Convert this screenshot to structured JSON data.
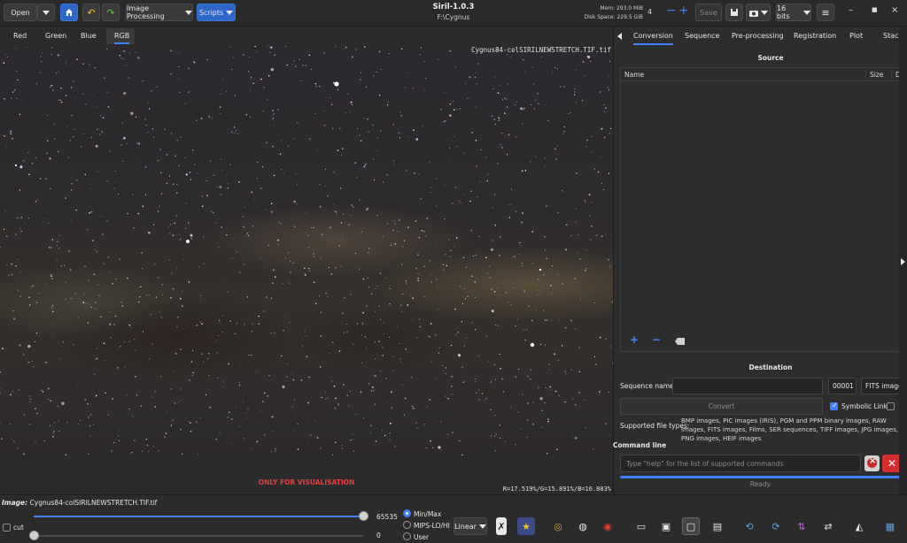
{
  "header": {
    "open_label": "Open",
    "image_processing_label": "Image Processing",
    "scripts_label": "Scripts",
    "app_title": "Siril-1.0.3",
    "path": "F:\\Cygnus",
    "mem": "Mem: 293.0 MiB",
    "disk": "Disk Space: 229.5 GiB",
    "thread_count": "4",
    "save_label": "Save",
    "bit_depth": "16 bits"
  },
  "channels": [
    "Red",
    "Green",
    "Blue",
    "RGB"
  ],
  "image": {
    "overlay_filename": "Cygnus84-colSIRILNEWSTRETCH.TIF.tif",
    "visualisation_note": "ONLY FOR VISUALISATION",
    "stats": "R=17.519%/G=15.891%/B=16.883%"
  },
  "panel": {
    "tabs": [
      "Conversion",
      "Sequence",
      "Pre-processing",
      "Registration",
      "Plot",
      "Stack"
    ],
    "source_heading": "Source",
    "col_name": "Name",
    "col_size": "Size",
    "col_date": "D",
    "destination_heading": "Destination",
    "sequence_name_label": "Sequence name:",
    "sequence_name_value": "",
    "start_index": "00001",
    "output_format": "FITS images",
    "convert_label": "Convert",
    "symbolic_link_label": "Symbolic Link",
    "supported_label": "Supported file types:",
    "supported_types": "BMP images, PIC images (IRIS), PGM and PPM binary images, RAW images, FITS images, Films, SER sequences, TIFF images, JPG images, PNG images, HEIF images",
    "command_line_label": "Command line",
    "command_placeholder": "Type \"help\" for the list of supported commands",
    "status": "Ready."
  },
  "bottom": {
    "image_label": "Image:",
    "image_file": "Cygnus84-colSIRILNEWSTRETCH.TIF.tif",
    "max_value": "65535",
    "min_value": "0",
    "cut_label": "cut",
    "modes": [
      "Min/Max",
      "MIPS-LO/HI",
      "User"
    ],
    "stretch": "Linear"
  }
}
